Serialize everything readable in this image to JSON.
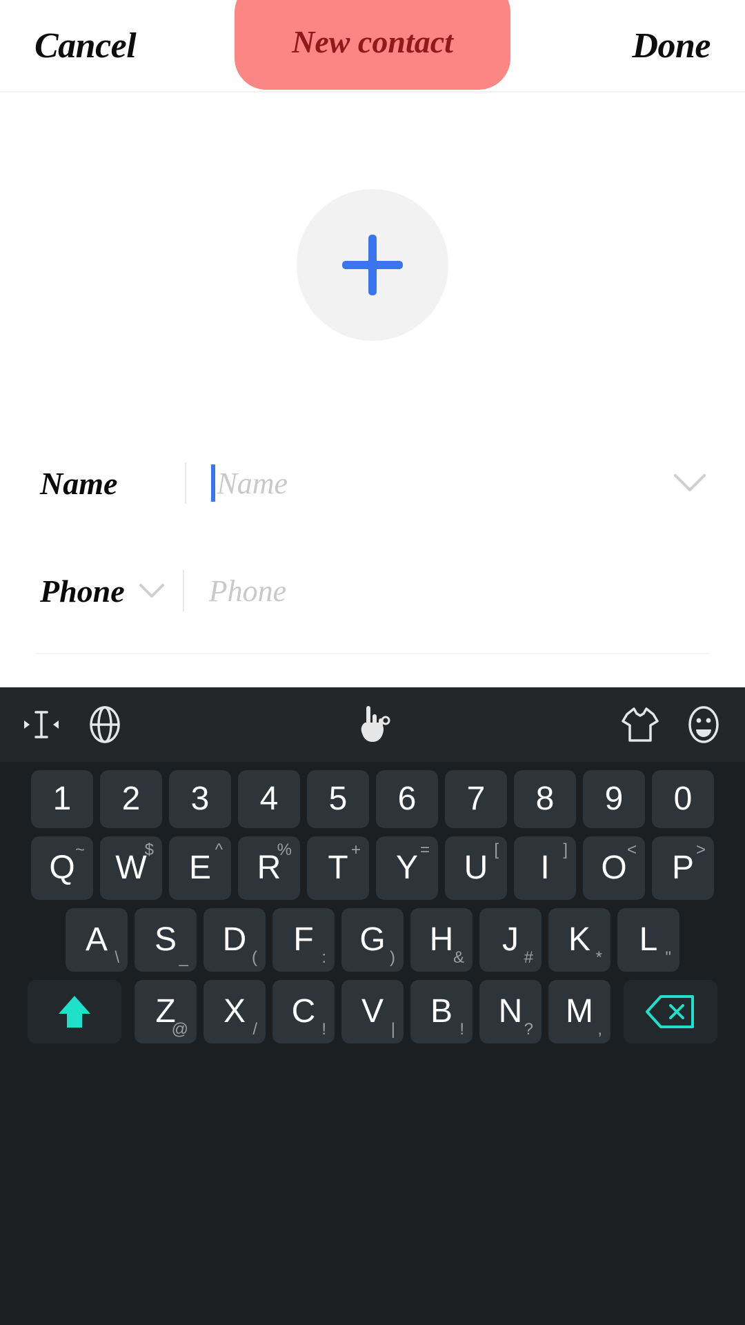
{
  "navbar": {
    "cancel_label": "Cancel",
    "title": "New contact",
    "done_label": "Done",
    "pill_color": "#fb8684",
    "title_color": "#8e1a1c"
  },
  "content": {
    "avatar": {
      "icon": "plus-icon",
      "background": "#f2f2f2",
      "plus_color": "#3a74ef"
    },
    "fields": [
      {
        "label": "Name",
        "placeholder": "Name",
        "value": "",
        "has_label_chevron": false,
        "has_row_chevron": true,
        "focused": true,
        "caret_color": "#3a74ef"
      },
      {
        "label": "Phone",
        "placeholder": "Phone",
        "value": "",
        "has_label_chevron": true,
        "has_row_chevron": false,
        "focused": false,
        "caret_color": "#3a74ef"
      }
    ]
  },
  "keyboard": {
    "accent_color": "#1fe0c8",
    "key_color": "#2d353a",
    "background": "#1c1f21",
    "toolbar": [
      {
        "icon": "text-cursor-icon",
        "name": "cursor-move-key"
      },
      {
        "icon": "globe-icon",
        "name": "language-key"
      },
      {
        "icon": "handwriting-icon",
        "name": "handwriting-key"
      },
      {
        "icon": "tshirt-icon",
        "name": "theme-key"
      },
      {
        "icon": "emoji-icon",
        "name": "emoji-key"
      }
    ],
    "rows": {
      "numbers": [
        {
          "main": "1"
        },
        {
          "main": "2"
        },
        {
          "main": "3"
        },
        {
          "main": "4"
        },
        {
          "main": "5"
        },
        {
          "main": "6"
        },
        {
          "main": "7"
        },
        {
          "main": "8"
        },
        {
          "main": "9"
        },
        {
          "main": "0"
        }
      ],
      "qwerty": [
        {
          "main": "Q",
          "sup": "~"
        },
        {
          "main": "W",
          "sup": "$"
        },
        {
          "main": "E",
          "sup": "^"
        },
        {
          "main": "R",
          "sup": "%"
        },
        {
          "main": "T",
          "sup": "+"
        },
        {
          "main": "Y",
          "sup": "="
        },
        {
          "main": "U",
          "sup": "["
        },
        {
          "main": "I",
          "sup": "]"
        },
        {
          "main": "O",
          "sup": "<"
        },
        {
          "main": "P",
          "sup": ">"
        }
      ],
      "asdf": [
        {
          "main": "A",
          "sub": "\\"
        },
        {
          "main": "S",
          "sub": "_"
        },
        {
          "main": "D",
          "sub": "("
        },
        {
          "main": "F",
          "sub": ":"
        },
        {
          "main": "G",
          "sub": ")"
        },
        {
          "main": "H",
          "sub": "&"
        },
        {
          "main": "J",
          "sub": "#"
        },
        {
          "main": "K",
          "sub": "*"
        },
        {
          "main": "L",
          "sub": "\""
        }
      ],
      "zxcv": [
        {
          "main": "Z",
          "sub": "@"
        },
        {
          "main": "X",
          "sub": "/"
        },
        {
          "main": "C",
          "sub": "!"
        },
        {
          "main": "V",
          "sub": "|"
        },
        {
          "main": "B",
          "sub": "!"
        },
        {
          "main": "N",
          "sub": "?"
        },
        {
          "main": "M",
          "sub": ","
        }
      ]
    },
    "shift": {
      "icon": "shift-arrow-icon"
    },
    "backspace": {
      "icon": "backspace-icon"
    }
  }
}
